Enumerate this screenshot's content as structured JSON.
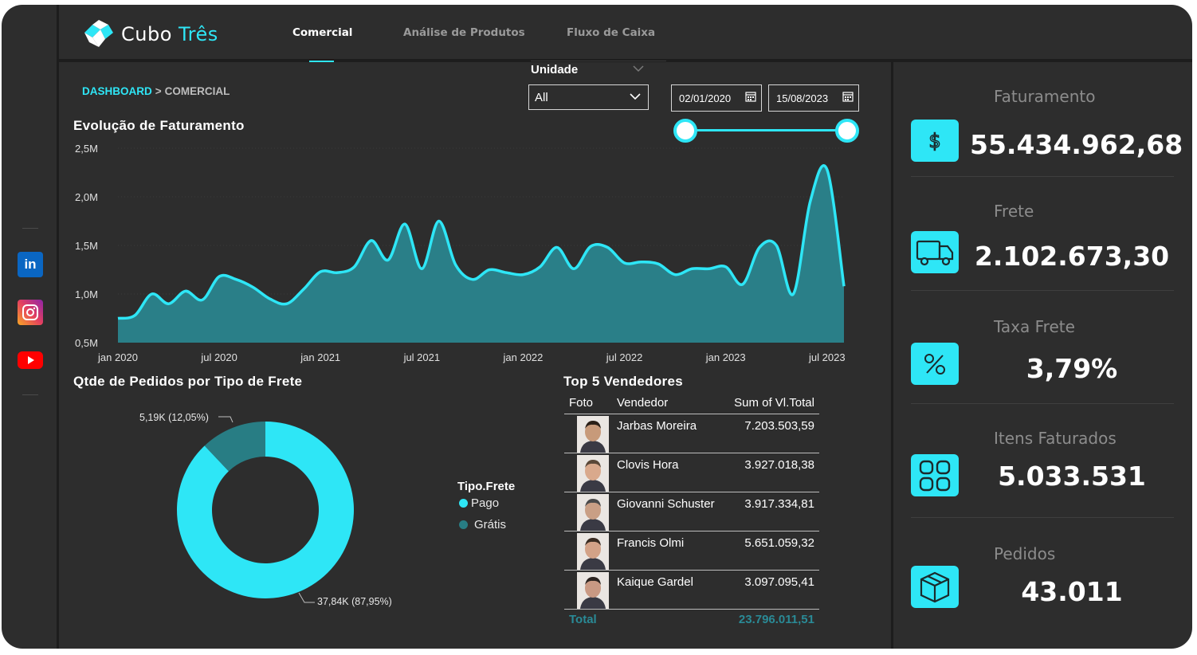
{
  "header": {
    "logo_text_1": "Cubo",
    "logo_text_2": "Três",
    "tabs": [
      {
        "label": "Comercial",
        "active": true
      },
      {
        "label": "Análise de Produtos",
        "active": false
      },
      {
        "label": "Fluxo de Caixa",
        "active": false
      }
    ]
  },
  "social": [
    {
      "icon": "linkedin-icon",
      "color": "#0a66c2"
    },
    {
      "icon": "instagram-icon",
      "color": "#e4405f"
    },
    {
      "icon": "youtube-icon",
      "color": "#ff0000"
    }
  ],
  "breadcrumb": {
    "home": "DASHBOARD",
    "separator": ">",
    "current": "COMERCIAL"
  },
  "filters": {
    "unit_label": "Unidade",
    "unit_value": "All",
    "date_start": "02/01/2020",
    "date_end": "15/08/2023"
  },
  "revenue_chart": {
    "title": "Evolução de Faturamento",
    "chart_data": {
      "type": "area",
      "x_ticks": [
        "jan 2020",
        "jul 2020",
        "jan 2021",
        "jul 2021",
        "jan 2022",
        "jul 2022",
        "jan 2023",
        "jul 2023"
      ],
      "y_ticks": [
        "0,5M",
        "1,0M",
        "1,5M",
        "2,0M",
        "2,5M"
      ],
      "ylim": [
        500000,
        2500000
      ],
      "x": [
        "2020-01",
        "2020-02",
        "2020-03",
        "2020-04",
        "2020-05",
        "2020-06",
        "2020-07",
        "2020-08",
        "2020-09",
        "2020-10",
        "2020-11",
        "2020-12",
        "2021-01",
        "2021-02",
        "2021-03",
        "2021-04",
        "2021-05",
        "2021-06",
        "2021-07",
        "2021-08",
        "2021-09",
        "2021-10",
        "2021-11",
        "2021-12",
        "2022-01",
        "2022-02",
        "2022-03",
        "2022-04",
        "2022-05",
        "2022-06",
        "2022-07",
        "2022-08",
        "2022-09",
        "2022-10",
        "2022-11",
        "2022-12",
        "2023-01",
        "2023-02",
        "2023-03",
        "2023-04",
        "2023-05",
        "2023-06",
        "2023-07",
        "2023-08"
      ],
      "values": [
        750000,
        780000,
        1000000,
        900000,
        1030000,
        940000,
        1180000,
        1150000,
        1070000,
        950000,
        900000,
        1050000,
        1230000,
        1220000,
        1280000,
        1550000,
        1350000,
        1720000,
        1260000,
        1750000,
        1300000,
        1150000,
        1250000,
        1220000,
        1200000,
        1280000,
        1480000,
        1260000,
        1490000,
        1480000,
        1320000,
        1330000,
        1310000,
        1200000,
        1260000,
        1260000,
        1280000,
        1100000,
        1480000,
        1500000,
        1000000,
        1950000,
        2280000,
        1080000
      ],
      "fill_color": "#2a7f88",
      "line_color": "#2ee6f6"
    }
  },
  "donut_chart": {
    "title": "Qtde de Pedidos por Tipo de Frete",
    "legend_title": "Tipo.Frete",
    "chart_data": {
      "type": "pie",
      "categories": [
        "Pago",
        "Grátis"
      ],
      "values": [
        37840,
        5190
      ],
      "percentages": [
        87.95,
        12.05
      ],
      "colors": [
        "#2ee6f6",
        "#287d84"
      ]
    },
    "label_pago": "37,84K (87,95%)",
    "label_gratis": "5,19K (12,05%)"
  },
  "top5": {
    "title": "Top 5 Vendedores",
    "columns": [
      "Foto",
      "Vendedor",
      "Sum of Vl.Total"
    ],
    "rows": [
      {
        "name": "Jarbas Moreira",
        "total": "7.203.503,59"
      },
      {
        "name": "Clovis Hora",
        "total": "3.927.018,38"
      },
      {
        "name": "Giovanni Schuster",
        "total": "3.917.334,81"
      },
      {
        "name": "Francis Olmi",
        "total": "5.651.059,32"
      },
      {
        "name": "Kaique Gardel",
        "total": "3.097.095,41"
      }
    ],
    "total_label": "Total",
    "total_value": "23.796.011,51"
  },
  "kpis": [
    {
      "title": "Faturamento",
      "value": "55.434.962,68",
      "icon": "dollar-icon"
    },
    {
      "title": "Frete",
      "value": "2.102.673,30",
      "icon": "truck-icon"
    },
    {
      "title": "Taxa Frete",
      "value": "3,79%",
      "icon": "percent-icon"
    },
    {
      "title": "Itens Faturados",
      "value": "5.033.531",
      "icon": "grid-icon"
    },
    {
      "title": "Pedidos",
      "value": "43.011",
      "icon": "box-icon"
    }
  ],
  "colors": {
    "accent": "#2ee6f6",
    "background": "#2d2d2d",
    "dark_line": "#1d1d1d"
  }
}
